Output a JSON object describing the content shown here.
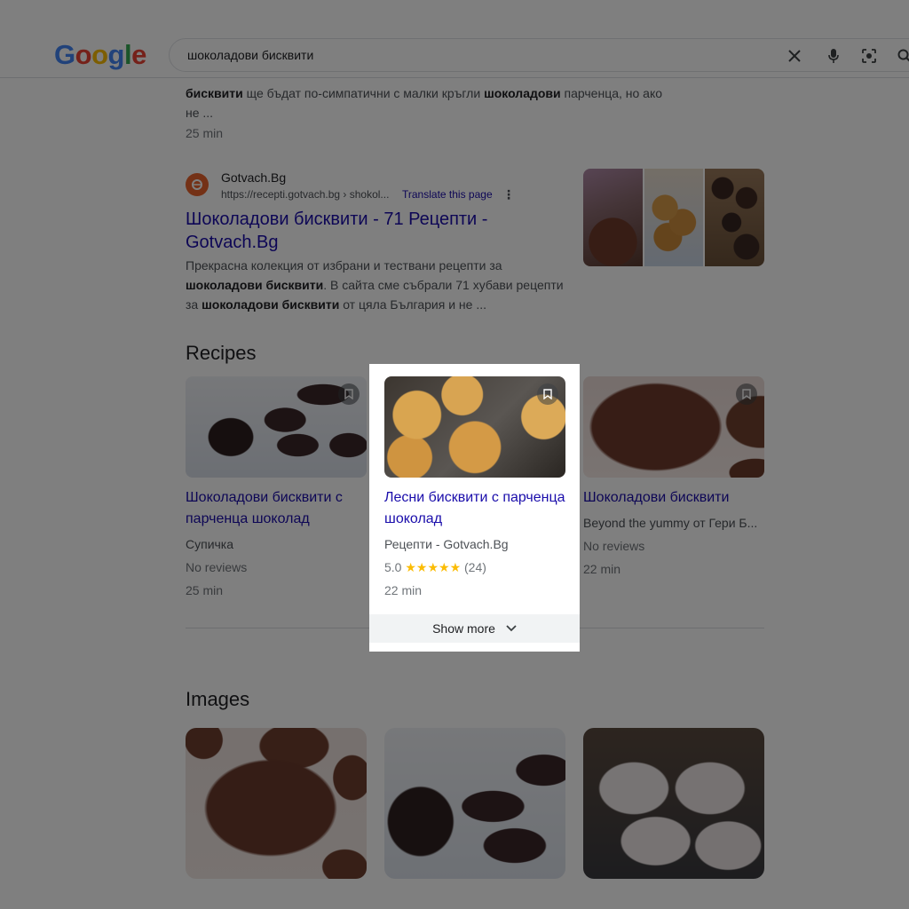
{
  "header": {
    "logo": "Google",
    "search_query": "шоколадови бисквити",
    "icons": [
      "close-icon",
      "microphone-icon",
      "lens-icon",
      "search-icon"
    ]
  },
  "top_result": {
    "snippet_prefix": "бисквити",
    "snippet_text": " ще бъдат по-симпатични с малки кръгли ",
    "snippet_bold": "шоколадови",
    "snippet_text_2": " парченца, но ако",
    "snippet_line2": "не ...",
    "time": "25 min"
  },
  "gotvach_result": {
    "site_name": "Gotvach.Bg",
    "url": "https://recepti.gotvach.bg › shokol...",
    "translate": "Translate this page",
    "title": "Шоколадови бисквити - 71 Рецепти - Gotvach.Bg",
    "snippet_1": "Прекрасна колекция от избрани и тествани рецепти за",
    "snippet_2_bold": "шоколадови бисквити",
    "snippet_2": ". В сайта сме събрали 71 хубави рецепти",
    "snippet_3_pre": "за ",
    "snippet_3_bold": "шоколадови бисквити",
    "snippet_3": " от цяла България и не ..."
  },
  "recipes": {
    "heading": "Recipes",
    "cards": [
      {
        "title": "Шоколадови бисквити с парченца шоколад",
        "source": "Супичка",
        "rating": "No reviews",
        "time": "25 min"
      },
      {
        "title": "Лесни бисквити с парченца шоколад",
        "source": "Рецепти - Gotvach.Bg",
        "rating_value": "5.0",
        "stars": "★★★★★",
        "rating_count": "(24)",
        "time": "22 min"
      },
      {
        "title": "Шоколадови бисквити",
        "source": "Beyond the yummy от Гери Б...",
        "rating": "No reviews",
        "time": "22 min"
      }
    ],
    "show_more": "Show more"
  },
  "images": {
    "heading": "Images"
  },
  "colors": {
    "link": "#1a0dab",
    "star": "#fbbc04",
    "overlay": "rgba(0,0,0,0.5)"
  }
}
